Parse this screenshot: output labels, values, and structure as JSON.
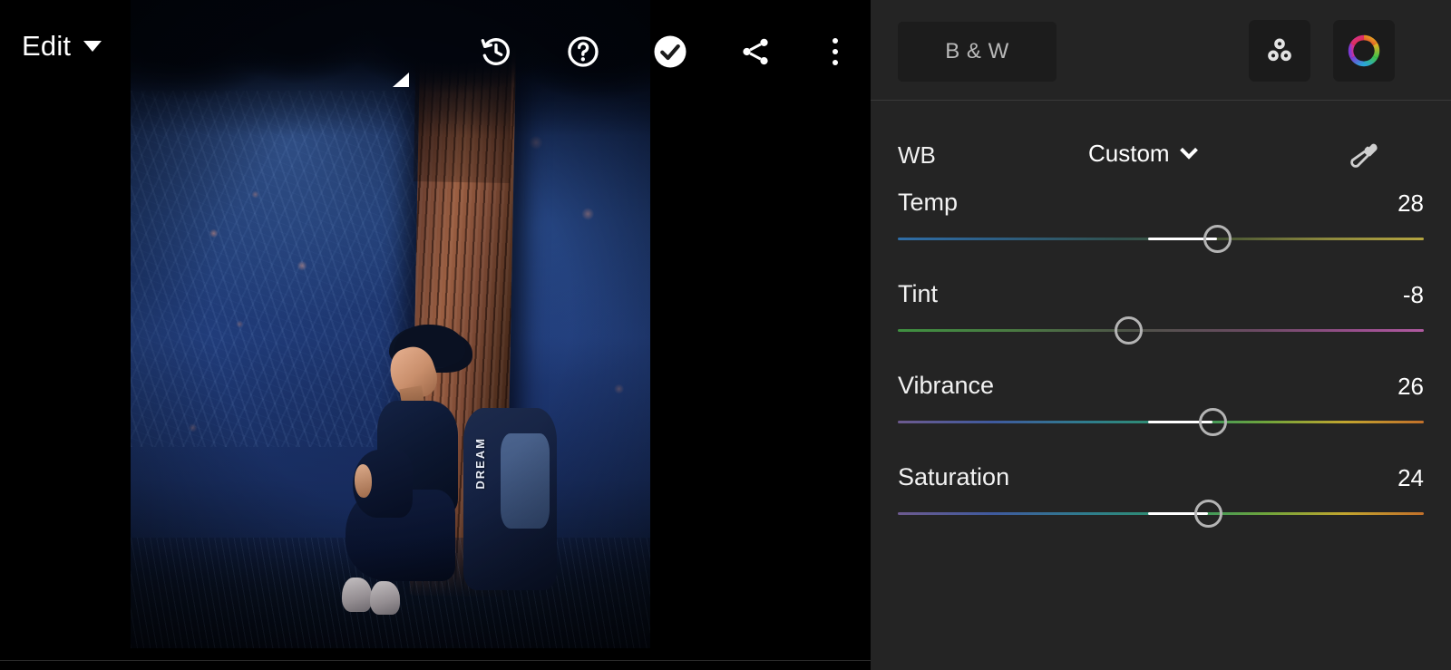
{
  "app": {
    "title": "Lightroom Photo Editor",
    "accent": "#ffffff",
    "panel_bg": "#242424",
    "canvas_bg": "#000000"
  },
  "viewer": {
    "menu": {
      "label": "Edit",
      "icon": "caret-down-icon"
    },
    "toolbar": [
      {
        "id": "history",
        "label": "History",
        "icon": "history-clock-icon"
      },
      {
        "id": "help",
        "label": "Help",
        "icon": "question-mark-circle-icon"
      },
      {
        "id": "done",
        "label": "Done",
        "icon": "checkmark-circle-icon"
      },
      {
        "id": "share",
        "label": "Share",
        "icon": "share-icon"
      },
      {
        "id": "more",
        "label": "More options",
        "icon": "more-vertical-icon"
      }
    ],
    "photo": {
      "alt": "Young person sitting against a tree trunk at dusk with a backpack",
      "backpack_text": "DREAM"
    }
  },
  "panel": {
    "header": {
      "bw_label": "B & W",
      "mix_icon": "color-mix-circles-icon",
      "color_icon": "color-wheel-icon"
    },
    "wb": {
      "label": "WB",
      "value": "Custom",
      "chevron_icon": "chevron-down-icon",
      "eyedropper_icon": "eyedropper-icon"
    },
    "sliders": [
      {
        "name": "Temp",
        "value": "28",
        "num": 28,
        "min": -100,
        "max": 100,
        "track": "blue-to-yellow"
      },
      {
        "name": "Tint",
        "value": "-8",
        "num": -8,
        "min": -100,
        "max": 100,
        "track": "green-to-magenta"
      },
      {
        "name": "Vibrance",
        "value": "26",
        "num": 26,
        "min": -100,
        "max": 100,
        "track": "spectrum"
      },
      {
        "name": "Saturation",
        "value": "24",
        "num": 24,
        "min": -100,
        "max": 100,
        "track": "spectrum"
      }
    ]
  }
}
